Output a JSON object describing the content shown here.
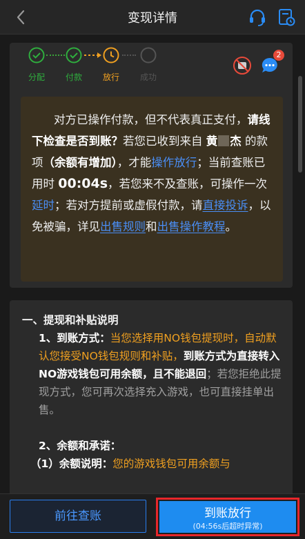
{
  "header": {
    "title": "变现详情"
  },
  "steps": [
    {
      "label": "分配",
      "state": "done",
      "color": "#2fae3e"
    },
    {
      "label": "付款",
      "state": "done",
      "color": "#2fae3e"
    },
    {
      "label": "放行",
      "state": "current",
      "color": "#f0a020"
    },
    {
      "label": "成功",
      "state": "pending",
      "color": "#555555"
    }
  ],
  "chat": {
    "badge_count": "2"
  },
  "notice": {
    "p1_a": "对方已操作付款，但不代表真正支付，",
    "p1_bold": "请线下检查是否到账？",
    "p1_b": "若您已收到来自",
    "payer_name": "黄",
    "payer_name_end": "杰",
    "p1_c": "的款项",
    "p1_bold2": "（余额有增加）",
    "p1_d": "，才能",
    "link_release": "操作放行",
    "p1_e": "；当前查账已用时",
    "elapsed": "00:04s",
    "p1_f": "，若您来不及查账，可操作一次",
    "link_delay": "延时",
    "p1_g": "；若对方提前或虚假付款，请",
    "link_complain": "直接投诉",
    "p1_h": "，以免被骗，详见",
    "link_rules": "出售规则",
    "p1_i": "和",
    "link_tutorial": "出售操作教程",
    "p1_j": "。"
  },
  "info": {
    "section1_title": "一、提现和补贴说明",
    "item1_label": "1、到账方式：",
    "item1_hl": "当您选择用NO钱包提现时，自动默认您接受NO钱包规则和补贴，",
    "item1_bold": "到账方式为直接转入NO游戏钱包可用余额，且不能退回",
    "item1_rest": "；若您拒绝此提现方式，您可再次选择充入游戏，也可直接挂单出售。",
    "item2_title": "2、余额和承诺：",
    "item2_sub_label": "（1）余额说明：",
    "item2_sub_text": "您的游戏钱包可用余额与"
  },
  "actions": {
    "goto_check": "前往查账",
    "release": "到账放行",
    "release_note": "(04:56s后超时异常)"
  },
  "colors": {
    "accent": "#1e8cf0",
    "success": "#2fae3e",
    "warning": "#f0a020",
    "highlight_border": "#e8262a"
  }
}
